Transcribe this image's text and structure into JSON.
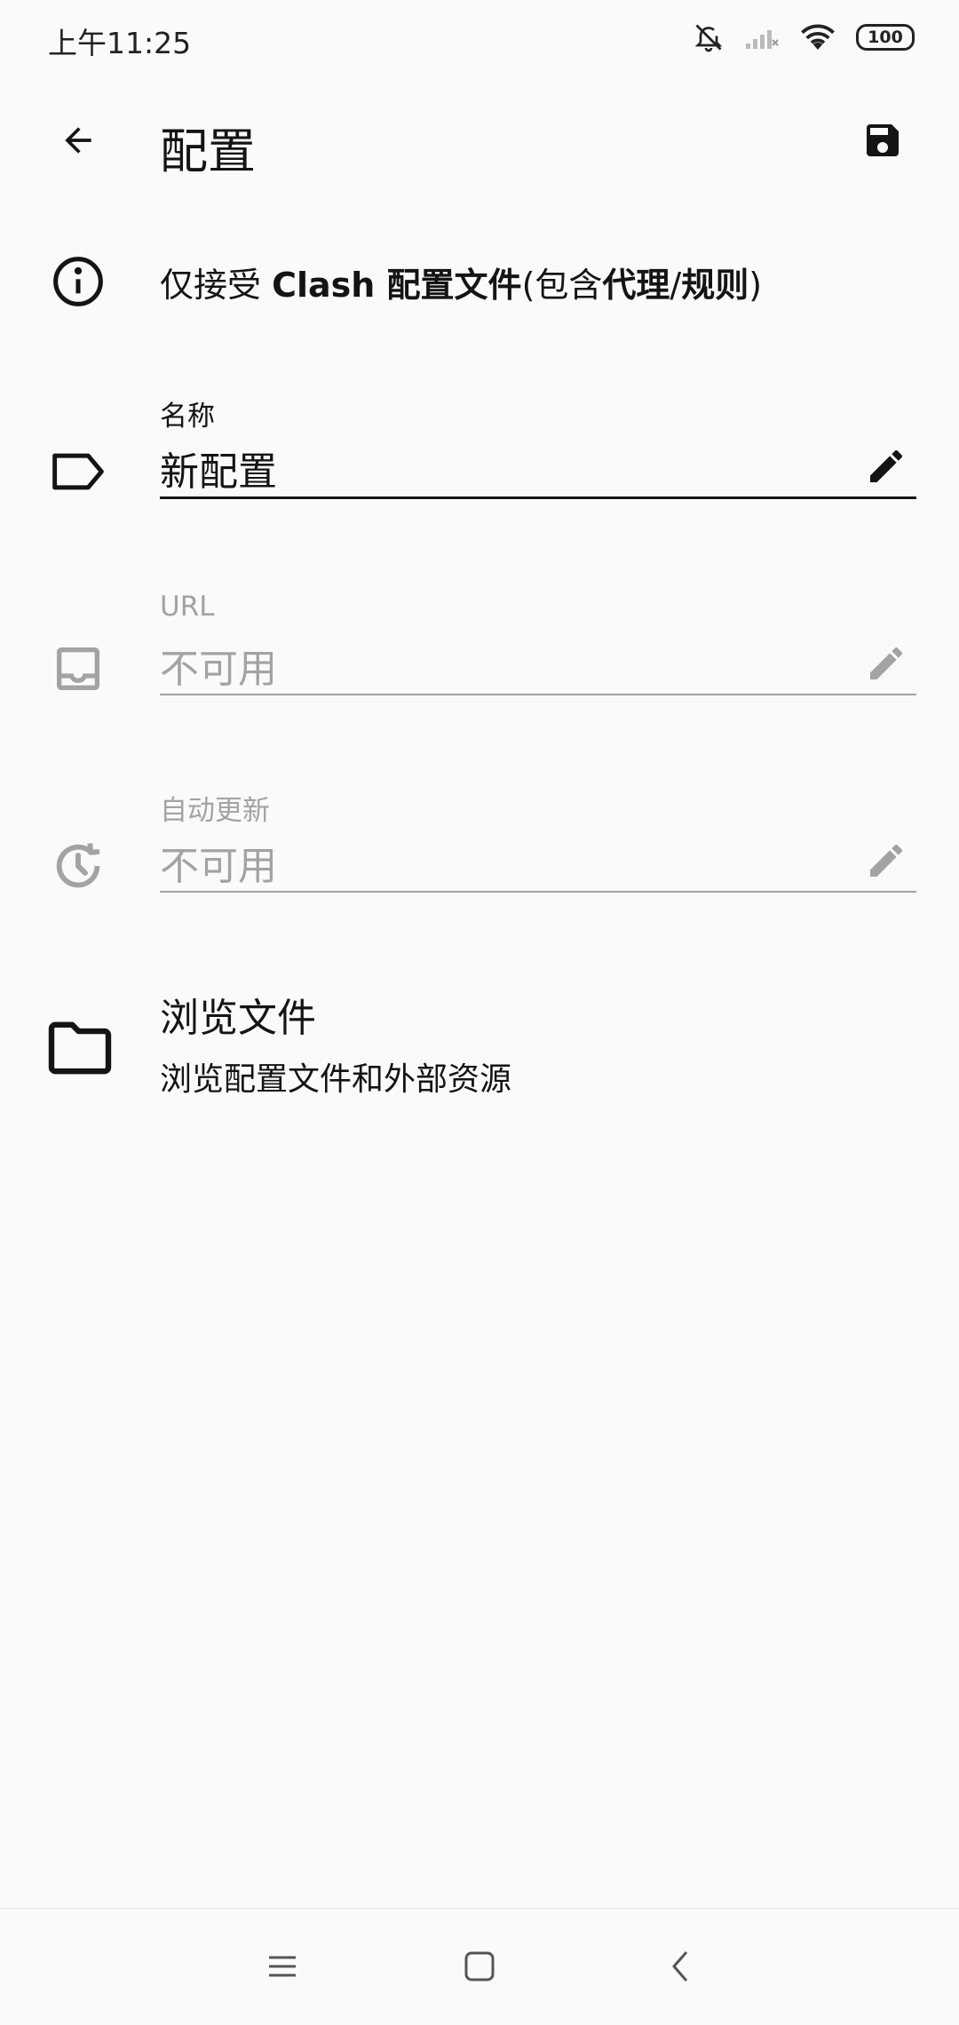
{
  "status_bar": {
    "time": "上午11:25",
    "battery": "100"
  },
  "app_bar": {
    "title": "配置"
  },
  "info": {
    "text_prefix": "仅接受 ",
    "text_bold1": "Clash 配置文件",
    "text_mid1": "(包含",
    "text_bold2": "代理",
    "text_mid2": "/",
    "text_bold3": "规则",
    "text_suffix": ")"
  },
  "fields": {
    "name": {
      "label": "名称",
      "value": "新配置"
    },
    "url": {
      "label": "URL",
      "value": "不可用"
    },
    "auto_update": {
      "label": "自动更新",
      "value": "不可用"
    }
  },
  "browse": {
    "title": "浏览文件",
    "subtitle": "浏览配置文件和外部资源"
  },
  "colors": {
    "background": "#fafafa",
    "text_primary": "#141414",
    "text_disabled": "#a3a3a3"
  },
  "icons": [
    "back-arrow-icon",
    "save-icon",
    "info-icon",
    "label-icon",
    "inbox-icon",
    "history-icon",
    "pencil-icon",
    "folder-icon",
    "menu-icon",
    "home-icon",
    "back-chevron-icon"
  ]
}
